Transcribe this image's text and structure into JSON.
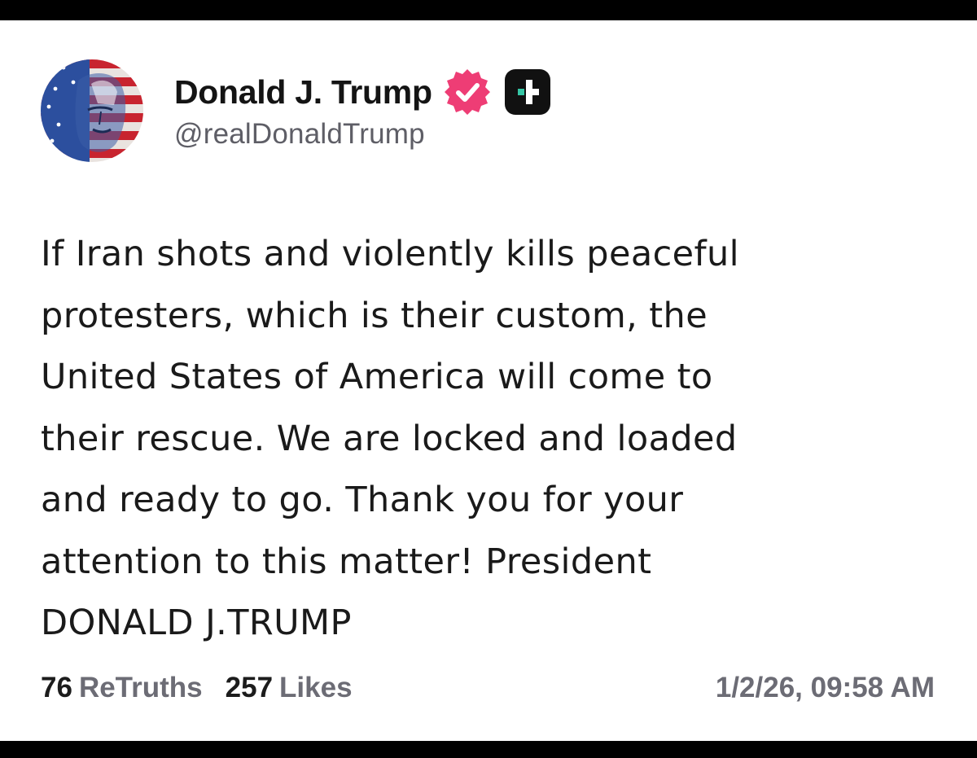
{
  "post": {
    "author": {
      "display_name": "Donald J. Trump",
      "handle": "@realDonaldTrump",
      "avatar_icon": "flag-portrait-avatar",
      "verified_icon": "verified-badge-icon",
      "plus_icon": "plus-badge-icon"
    },
    "body": "If Iran shots and violently kills peaceful\nprotesters, which is their custom, the\nUnited States of America will come to\ntheir rescue. We are locked and loaded\nand ready to go. Thank you for your\nattention to this matter! President\nDONALD J.TRUMP",
    "stats": {
      "retruths_count": "76",
      "retruths_label": "ReTruths",
      "likes_count": "257",
      "likes_label": "Likes"
    },
    "timestamp": "1/2/26, 09:58 AM"
  },
  "colors": {
    "background": "#ffffff",
    "frame": "#000000",
    "verified_badge": "#ee3d75",
    "plus_badge": "#111111",
    "plus_badge_accent": "#35c6a5",
    "muted_text": "#6c6c75"
  }
}
